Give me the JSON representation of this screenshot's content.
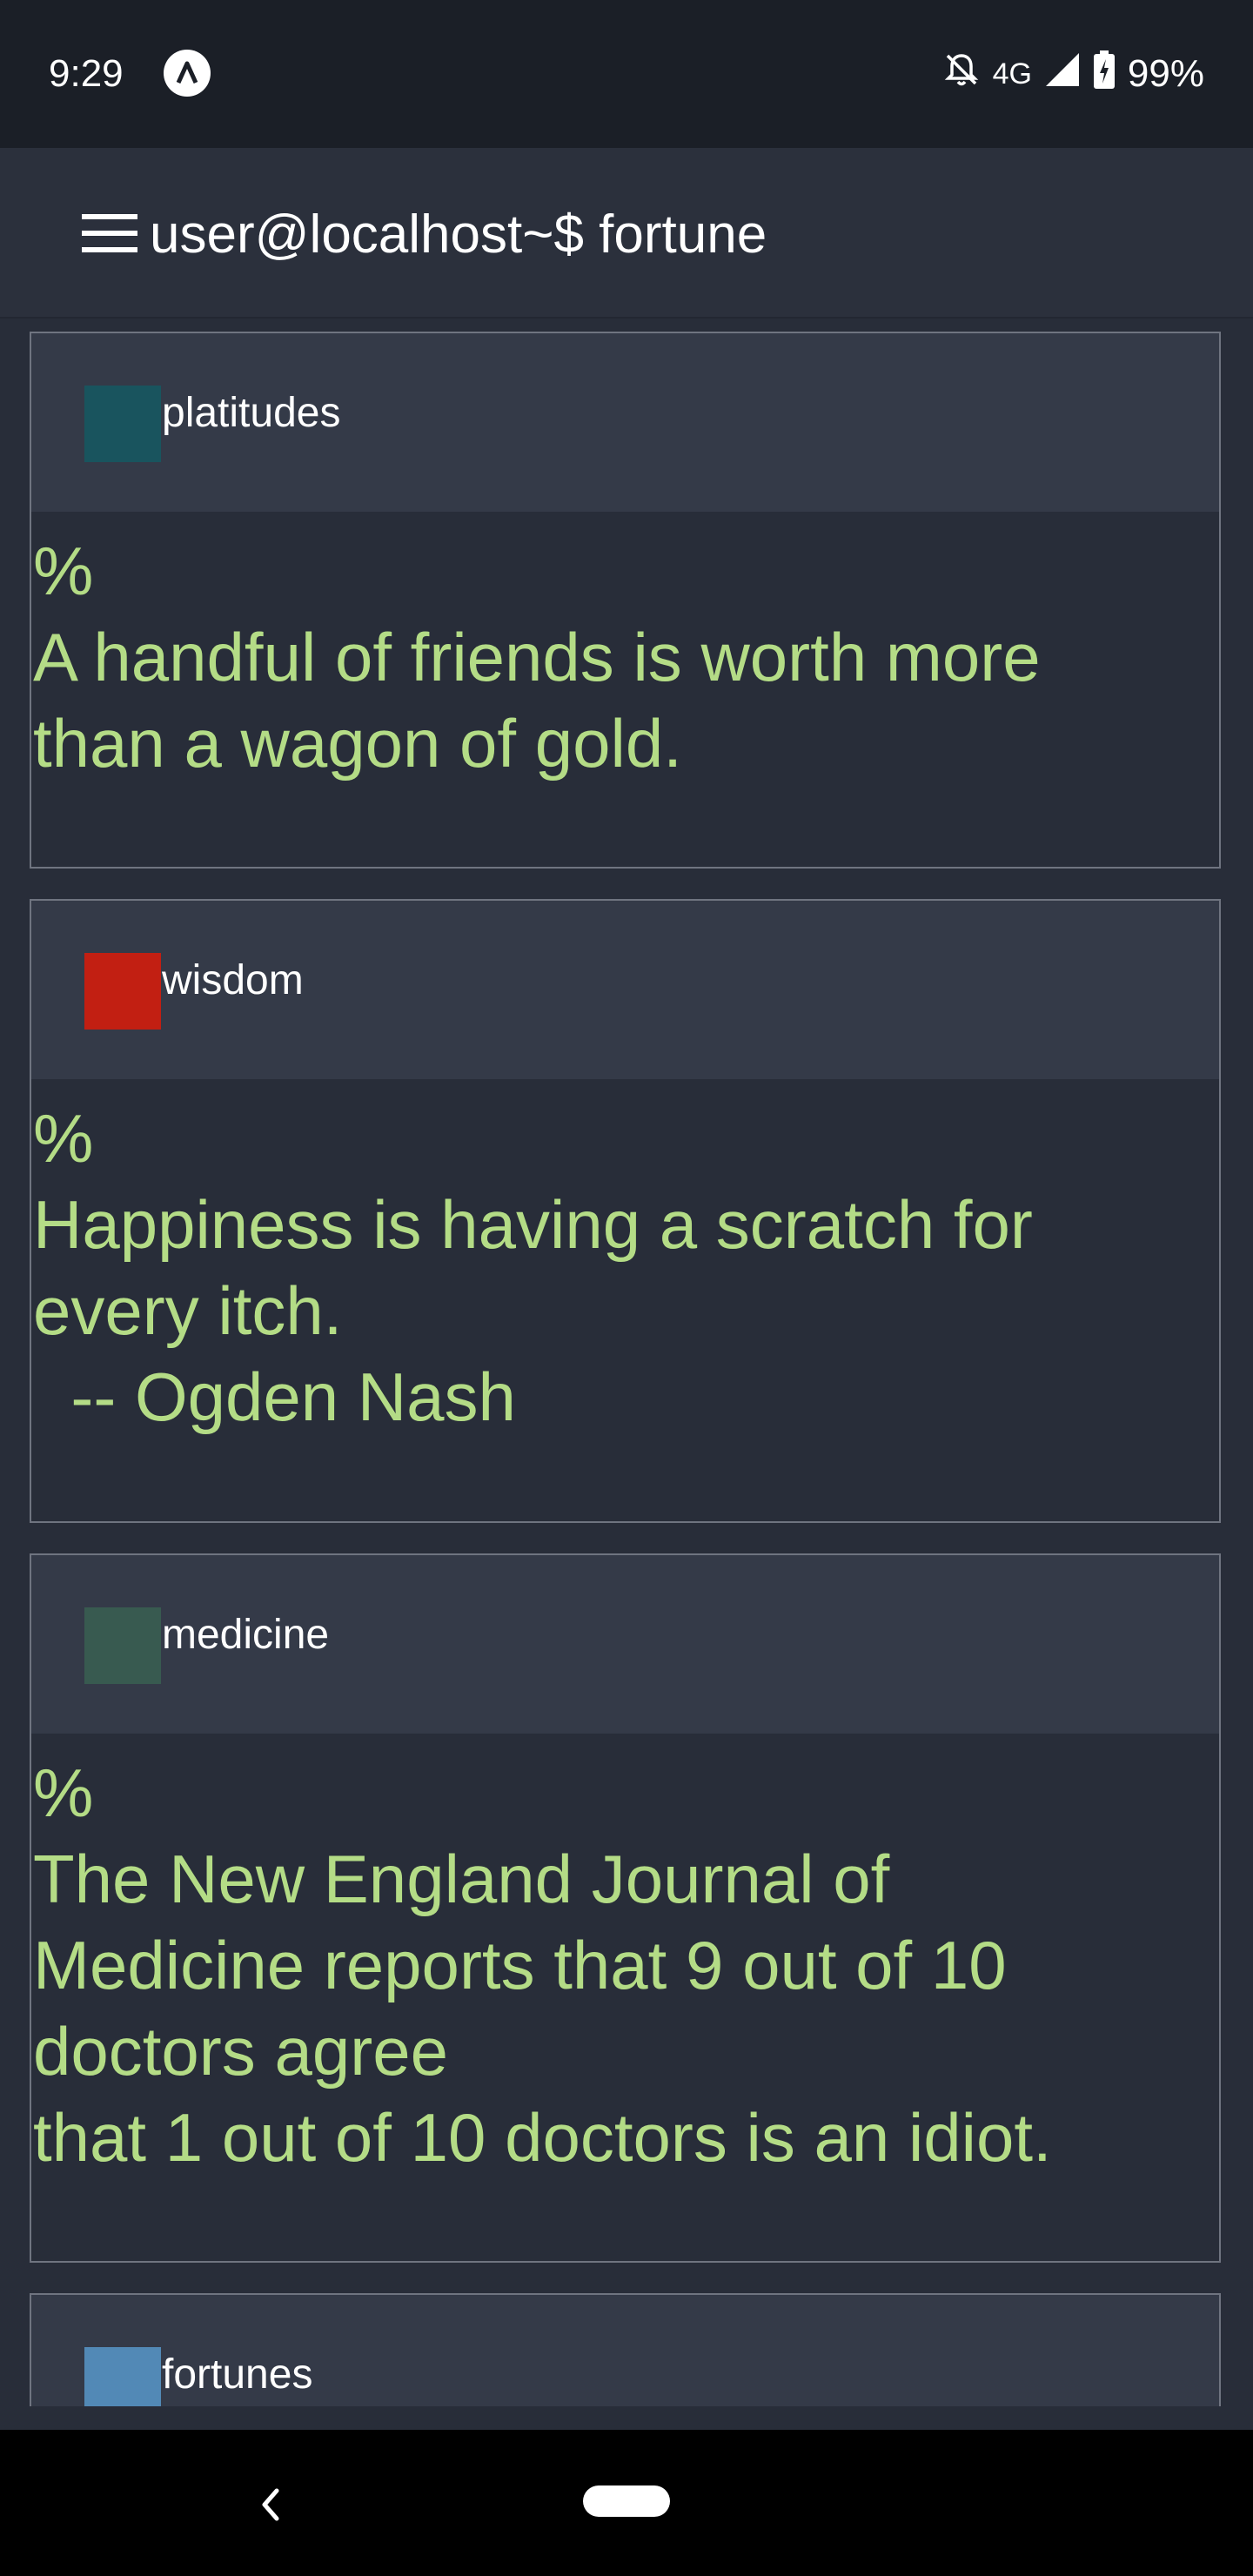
{
  "status_bar": {
    "time": "9:29",
    "network": "4G",
    "battery": "99%",
    "icons": [
      "app-launcher-icon",
      "notifications-off-icon",
      "signal-icon",
      "battery-charging-icon"
    ]
  },
  "app_bar": {
    "title": "user@localhost~$ fortune",
    "menu_icon": "hamburger-menu-icon"
  },
  "cards": [
    {
      "category": "platitudes",
      "color": "#19545e",
      "text": "%\nA handful of friends is worth more\nthan a wagon of gold."
    },
    {
      "category": "wisdom",
      "color": "#c21f12",
      "text": "%\nHappiness is having a scratch for\nevery itch.\n  -- Ogden Nash"
    },
    {
      "category": "medicine",
      "color": "#385a50",
      "text": "%\nThe New England Journal of\nMedicine reports that 9 out of 10\ndoctors agree\nthat 1 out of 10 doctors is an idiot."
    },
    {
      "category": "fortunes",
      "color": "#5289b6",
      "text": ""
    }
  ],
  "nav_bar": {
    "back_icon": "back-chevron-icon",
    "home_icon": "home-pill-icon"
  }
}
